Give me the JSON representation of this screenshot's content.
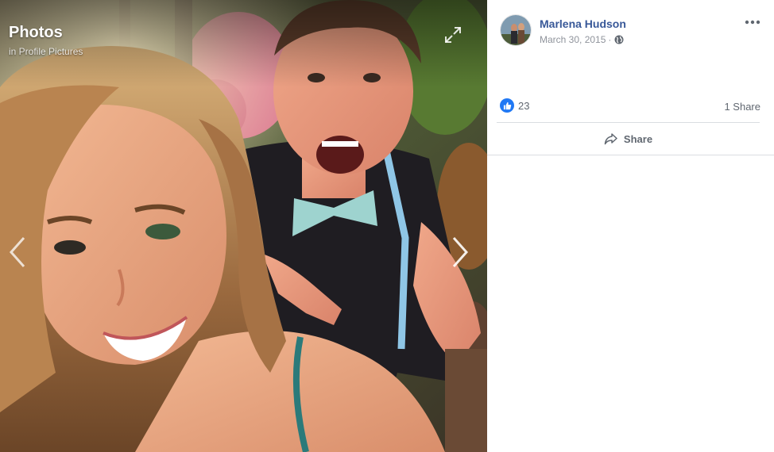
{
  "viewer": {
    "album_title": "Photos",
    "album_subtitle": "in Profile Pictures",
    "controls": {
      "expand_icon": "expand-arrows-icon",
      "prev_icon": "chevron-left-icon",
      "next_icon": "chevron-right-icon"
    }
  },
  "post": {
    "author": "Marlena Hudson",
    "date": "March 30, 2015",
    "separator": "·",
    "privacy_icon": "globe-icon",
    "more_icon": "more-dots-icon",
    "like_count": "23",
    "share_count": "1 Share",
    "share_button_label": "Share"
  },
  "colors": {
    "link_blue": "#385898",
    "like_blue": "#2078f4",
    "meta_gray": "#90949c",
    "action_gray": "#606770",
    "divider": "#dadde1"
  }
}
